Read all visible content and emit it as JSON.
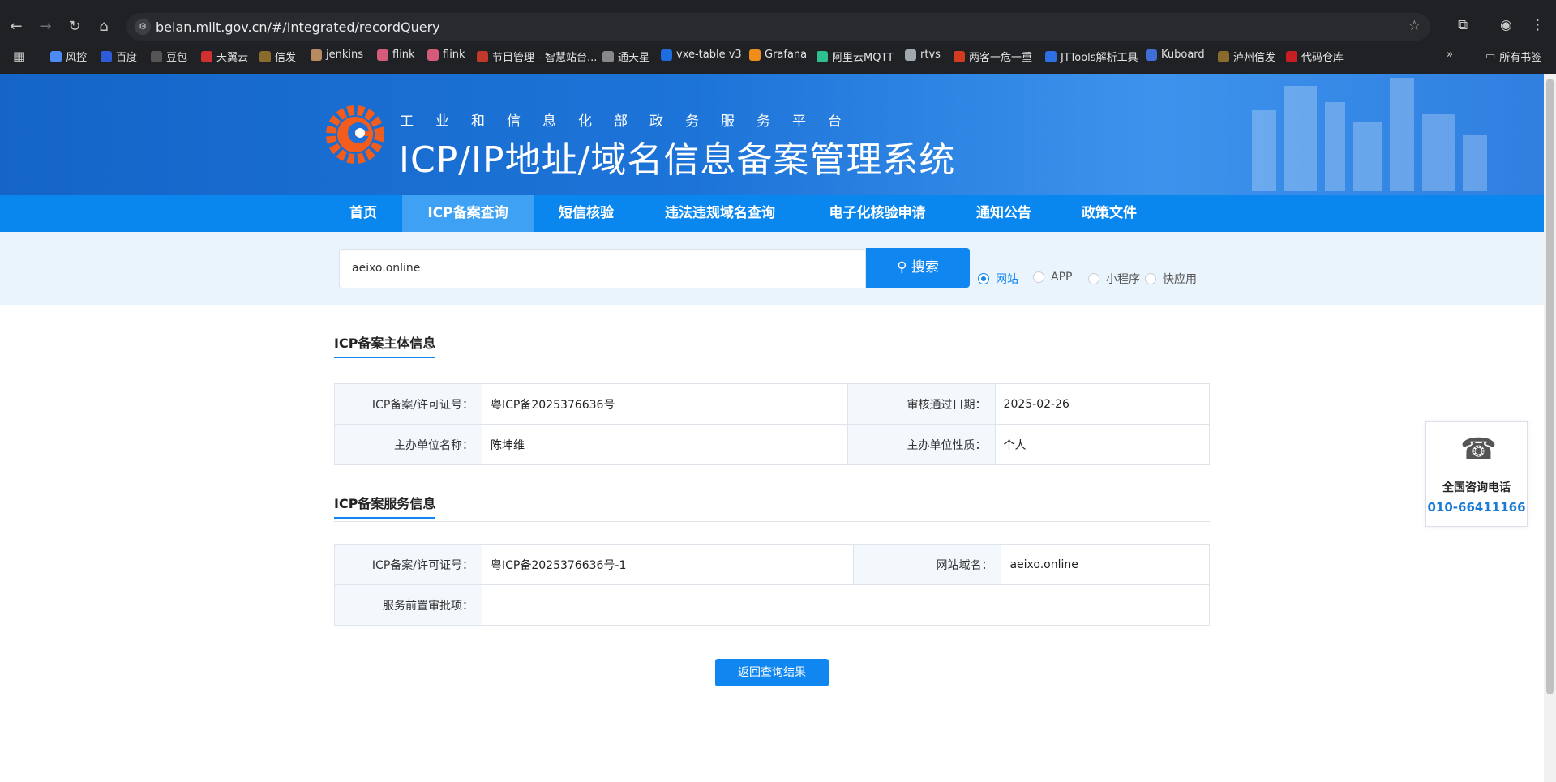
{
  "browser": {
    "url": "beian.miit.gov.cn/#/Integrated/recordQuery",
    "bookmarks": [
      {
        "label": "风控",
        "icon": "bookmark-icon",
        "color": "#4c8bf5"
      },
      {
        "label": "百度",
        "icon": "baidu-icon",
        "color": "#2e5bd8"
      },
      {
        "label": "豆包",
        "icon": "doubao-icon",
        "color": "#555"
      },
      {
        "label": "天翼云",
        "icon": "cloud-icon",
        "color": "#d03030"
      },
      {
        "label": "信发",
        "icon": "pen-icon",
        "color": "#8a6b2e"
      },
      {
        "label": "jenkins",
        "icon": "jenkins-icon",
        "color": "#b78a60"
      },
      {
        "label": "flink",
        "icon": "flink-icon",
        "color": "#d45c7a"
      },
      {
        "label": "flink",
        "icon": "flink-icon",
        "color": "#d45c7a"
      },
      {
        "label": "节目管理 - 智慧站台...",
        "icon": "program-icon",
        "color": "#c0392b"
      },
      {
        "label": "通天星",
        "icon": "star-icon",
        "color": "#888"
      },
      {
        "label": "vxe-table v3",
        "icon": "vxe-icon",
        "color": "#1e6ddf"
      },
      {
        "label": "Grafana",
        "icon": "grafana-icon",
        "color": "#f08c1a"
      },
      {
        "label": "阿里云MQTT",
        "icon": "mqtt-icon",
        "color": "#2fbf8f"
      },
      {
        "label": "rtvs",
        "icon": "doc-icon",
        "color": "#a0a8b0"
      },
      {
        "label": "两客一危一重",
        "icon": "emblem-icon",
        "color": "#d23b20"
      },
      {
        "label": "JTTools解析工具",
        "icon": "tool-icon",
        "color": "#2f6fe4"
      },
      {
        "label": "Kuboard",
        "icon": "kuboard-icon",
        "color": "#3f6ed8"
      },
      {
        "label": "泸州信发",
        "icon": "pen-icon",
        "color": "#8a6b2e"
      },
      {
        "label": "代码仓库",
        "icon": "gitee-icon",
        "color": "#c71d23"
      }
    ],
    "all_bookmarks": "所有书签"
  },
  "header": {
    "subtitle": "工业和信息化部政务服务平台",
    "title": "ICP/IP地址/域名信息备案管理系统"
  },
  "menu": [
    "首页",
    "ICP备案查询",
    "短信核验",
    "违法违规域名查询",
    "电子化核验申请",
    "通知公告",
    "政策文件"
  ],
  "search": {
    "value": "aeixo.online",
    "button": "搜索",
    "options": [
      "网站",
      "APP",
      "小程序",
      "快应用"
    ]
  },
  "subject": {
    "title": "ICP备案主体信息",
    "rows": [
      {
        "k1": "ICP备案/许可证号：",
        "v1": "粤ICP备2025376636号",
        "k2": "审核通过日期：",
        "v2": "2025-02-26"
      },
      {
        "k1": "主办单位名称：",
        "v1": "陈坤维",
        "k2": "主办单位性质：",
        "v2": "个人"
      }
    ]
  },
  "service": {
    "title": "ICP备案服务信息",
    "row1": {
      "k1": "ICP备案/许可证号：",
      "v1": "粤ICP备2025376636号-1",
      "k2": "网站域名：",
      "v2": "aeixo.online"
    },
    "row2": {
      "k": "服务前置审批项：",
      "v": ""
    }
  },
  "return_button": "返回查询结果",
  "contact": {
    "label": "全国咨询电话",
    "phone": "010-66411166"
  }
}
